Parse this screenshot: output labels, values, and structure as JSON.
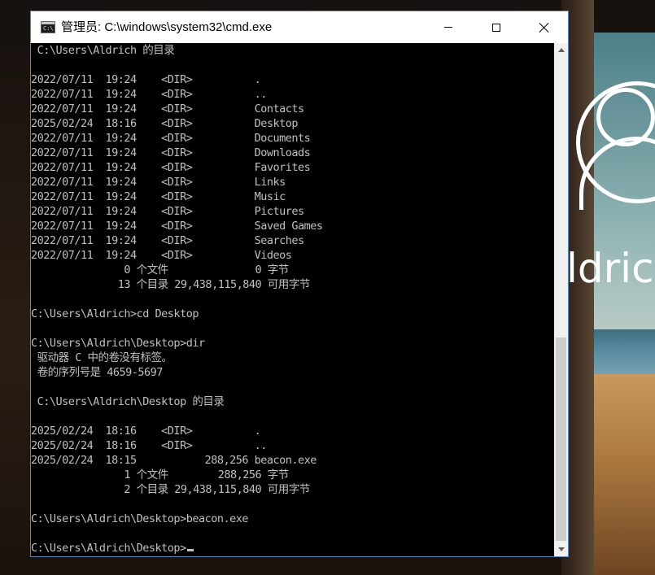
{
  "window": {
    "title": "管理员: C:\\windows\\system32\\cmd.exe",
    "icon_label": "C:\\",
    "buttons": {
      "minimize": "minimize-icon",
      "maximize": "maximize-icon",
      "close": "close-icon"
    }
  },
  "console": {
    "lines": [
      " C:\\Users\\Aldrich 的目录",
      "",
      "2022/07/11  19:24    <DIR>          .",
      "2022/07/11  19:24    <DIR>          ..",
      "2022/07/11  19:24    <DIR>          Contacts",
      "2025/02/24  18:16    <DIR>          Desktop",
      "2022/07/11  19:24    <DIR>          Documents",
      "2022/07/11  19:24    <DIR>          Downloads",
      "2022/07/11  19:24    <DIR>          Favorites",
      "2022/07/11  19:24    <DIR>          Links",
      "2022/07/11  19:24    <DIR>          Music",
      "2022/07/11  19:24    <DIR>          Pictures",
      "2022/07/11  19:24    <DIR>          Saved Games",
      "2022/07/11  19:24    <DIR>          Searches",
      "2022/07/11  19:24    <DIR>          Videos",
      "               0 个文件              0 字节",
      "              13 个目录 29,438,115,840 可用字节",
      "",
      "C:\\Users\\Aldrich>cd Desktop",
      "",
      "C:\\Users\\Aldrich\\Desktop>dir",
      " 驱动器 C 中的卷没有标签。",
      " 卷的序列号是 4659-5697",
      "",
      " C:\\Users\\Aldrich\\Desktop 的目录",
      "",
      "2025/02/24  18:16    <DIR>          .",
      "2025/02/24  18:16    <DIR>          ..",
      "2025/02/24  18:15           288,256 beacon.exe",
      "               1 个文件        288,256 字节",
      "               2 个目录 29,438,115,840 可用字节",
      "",
      "C:\\Users\\Aldrich\\Desktop>beacon.exe",
      ""
    ],
    "prompt": "C:\\Users\\Aldrich\\Desktop>"
  },
  "lock_screen": {
    "user_name_fragment": "ldric",
    "avatar_icon": "user-avatar-icon"
  },
  "colors": {
    "console_bg": "#000000",
    "console_fg": "#c0c0c0",
    "titlebar_bg": "#ffffff",
    "window_border": "#5a86b8"
  }
}
